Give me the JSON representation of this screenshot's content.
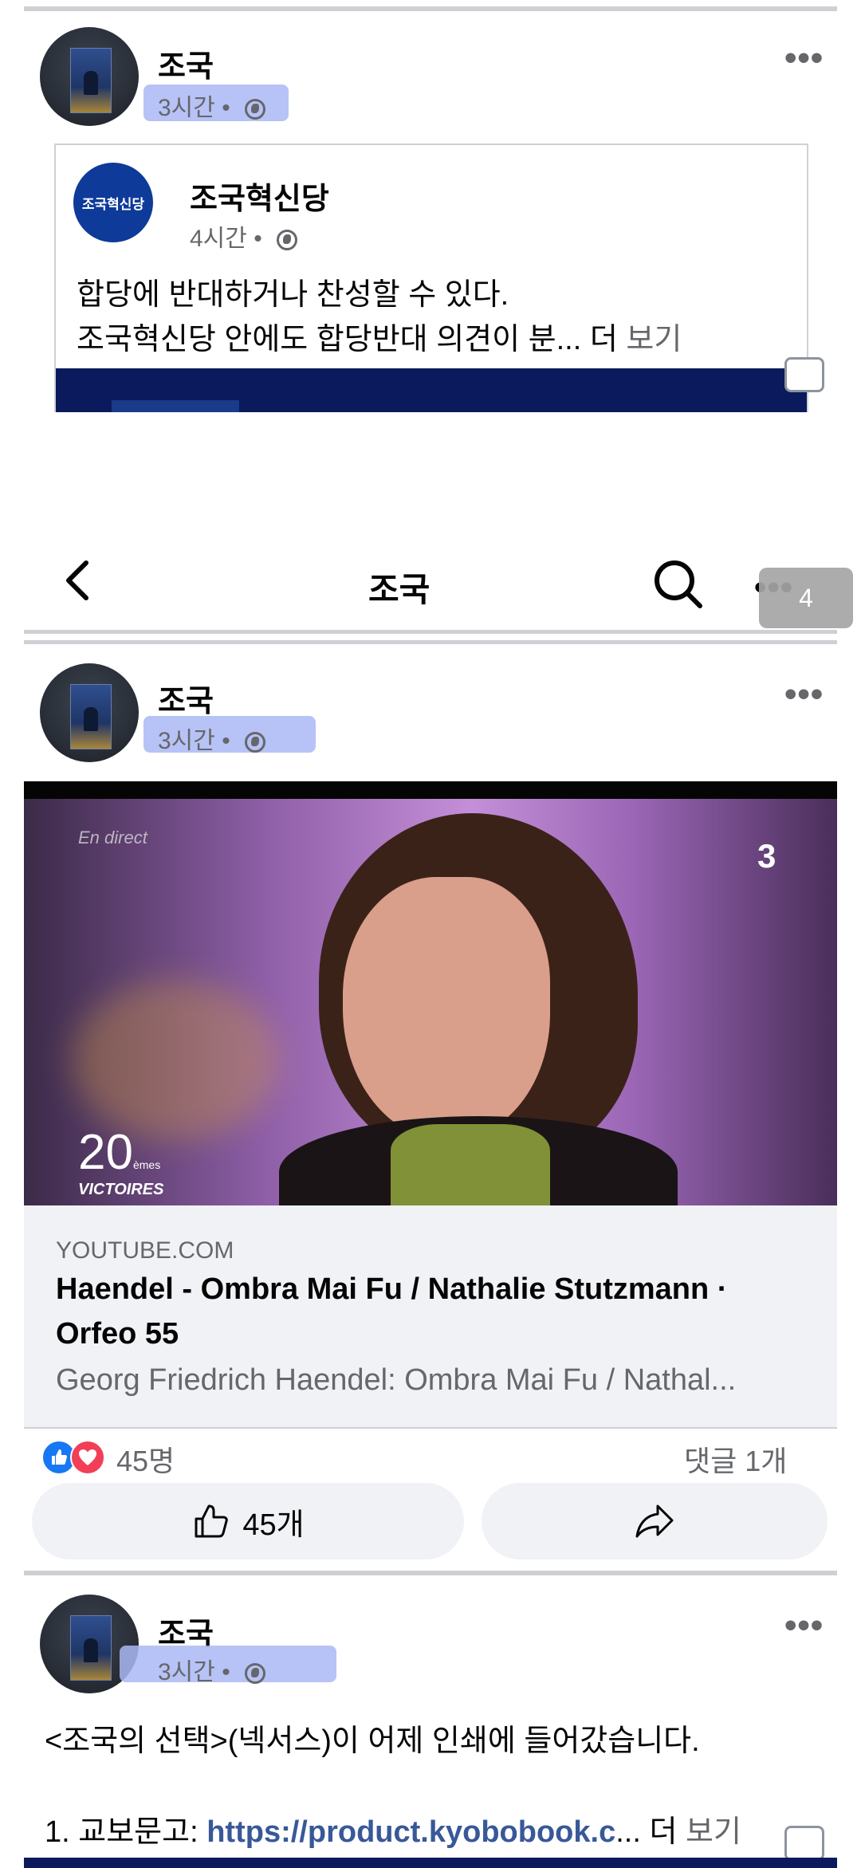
{
  "post1": {
    "author": "조국",
    "time": "3시간",
    "dot": "•",
    "shared": {
      "author": "조국혁신당",
      "avatar_text": "조국혁신당",
      "time": "4시간",
      "dot": "•",
      "line1": "합당에 반대하거나 찬성할 수 있다.",
      "line2": "조국혁신당 안에도 합당반대 의견이 분...",
      "more_de": "더",
      "more_bogi": "보기"
    }
  },
  "header": {
    "title": "조국",
    "badge": "4"
  },
  "post2": {
    "author": "조국",
    "time": "3시간",
    "dot": "•",
    "video": {
      "overlay_top": "En direct",
      "overlay_logo": "3",
      "overlay_bottom_num": "20",
      "overlay_bottom_sub": "èmes",
      "overlay_bottom_text": "VICTOIRES"
    },
    "link": {
      "domain": "YOUTUBE.COM",
      "title_line1": "Haendel - Ombra Mai Fu / Nathalie Stutzmann ·",
      "title_line2": "Orfeo 55",
      "description": "Georg Friedrich Haendel: Ombra Mai Fu / Nathal..."
    },
    "reactions": {
      "count": "45명",
      "comments": "댓글 1개"
    },
    "actions": {
      "like_label": "45개"
    },
    "colors": {
      "like": "#1877f2",
      "love": "#f33e58"
    }
  },
  "post3": {
    "author": "조국",
    "time": "3시간",
    "dot": "•",
    "line1": "<조국의 선택>(넥서스)이 어제 인쇄에 들어갔습니다.",
    "line2_prefix": "1. 교보문고: ",
    "line2_link": "https://product.kyobobook.c",
    "line2_suffix": "...",
    "more_de": "더",
    "more_bogi": "보기"
  },
  "colors": {
    "link": "#385898",
    "highlight": "#aab8f5",
    "navy": "#0a1a5c"
  }
}
